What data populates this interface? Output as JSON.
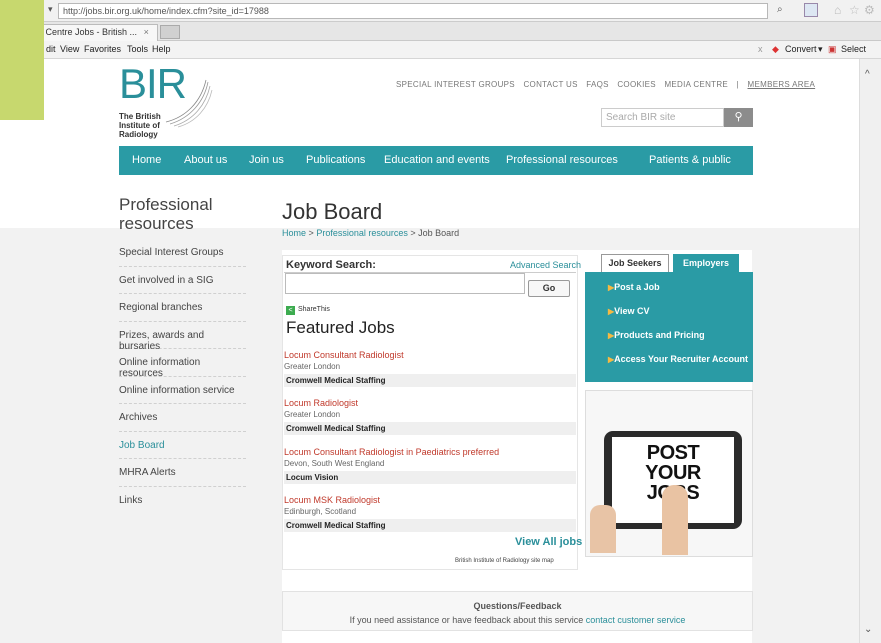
{
  "browser": {
    "url": "http://jobs.bir.org.uk/home/index.cfm?site_id=17988",
    "tab_label": "er Centre Jobs - British ...",
    "menu": [
      "dit",
      "View",
      "Favorites",
      "Tools",
      "Help"
    ],
    "convert_label": "Convert",
    "select_label": "Select"
  },
  "header": {
    "logo": "BIR",
    "logo_sub": "The British Institute of Radiology",
    "top_links": [
      "SPECIAL INTEREST GROUPS",
      "CONTACT US",
      "FAQS",
      "COOKIES",
      "MEDIA CENTRE",
      "|",
      "MEMBERS AREA"
    ],
    "search_placeholder": "Search BIR site"
  },
  "nav": [
    "Home",
    "About us",
    "Join us",
    "Publications",
    "Education and events",
    "Professional resources",
    "Patients & public"
  ],
  "sidebar": {
    "heading": "Professional resources",
    "items": [
      "Special Interest Groups",
      "Get involved in a SIG",
      "Regional branches",
      "Prizes, awards and bursaries",
      "Online information resources",
      "Online information service",
      "Archives",
      "Job Board",
      "MHRA Alerts",
      "Links"
    ],
    "active_index": 7
  },
  "main": {
    "title": "Job Board",
    "breadcrumb": [
      "Home",
      ">",
      "Professional resources",
      ">",
      "Job Board"
    ],
    "keyword_label": "Keyword Search:",
    "advanced_search": "Advanced Search",
    "go_label": "Go",
    "share_label": "ShareThis",
    "featured_title": "Featured Jobs",
    "jobs": [
      {
        "title": "Locum Consultant Radiologist",
        "location": "Greater London",
        "company": "Cromwell Medical Staffing"
      },
      {
        "title": "Locum Radiologist",
        "location": "Greater London",
        "company": "Cromwell Medical Staffing"
      },
      {
        "title": "Locum Consultant Radiologist in Paediatrics preferred",
        "location": "Devon, South West England",
        "company": "Locum Vision"
      },
      {
        "title": "Locum MSK Radiologist",
        "location": "Edinburgh, Scotland",
        "company": "Cromwell Medical Staffing"
      }
    ],
    "view_all": "View All jobs",
    "site_map": "British Institute of Radiology site map"
  },
  "right_panel": {
    "tab_seekers": "Job Seekers",
    "tab_employers": "Employers",
    "links": [
      "Post a Job",
      "View CV",
      "Products and Pricing",
      "Access Your Recruiter Account"
    ],
    "ad_text": [
      "POST",
      "YOUR",
      "JOBS"
    ]
  },
  "feedback": {
    "title": "Questions/Feedback",
    "text": "If you need assistance or have feedback about this service",
    "link": "contact customer service"
  }
}
